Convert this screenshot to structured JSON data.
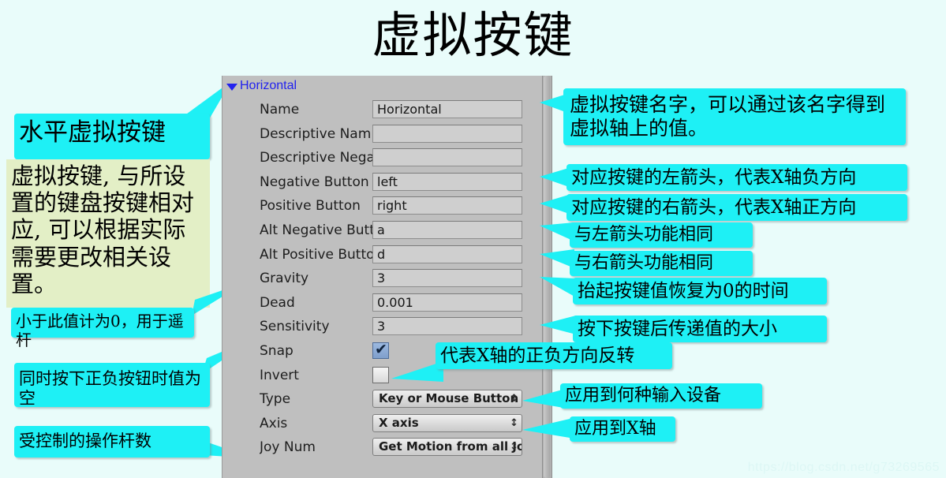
{
  "page": {
    "title": "虚拟按键",
    "watermark": "https://blog.csdn.net/g73269565",
    "background_color": "#e9fcfa",
    "note_color": "#1ef0f5",
    "note_green_color": "#e3efc6",
    "panel_color": "#bfbfbf",
    "accent_color": "#2222ee"
  },
  "inspector": {
    "foldout": {
      "label": "Horizontal",
      "icon": "triangle-down-icon",
      "expanded": true
    },
    "rows": [
      {
        "label": "Name",
        "kind": "text",
        "value": "Horizontal"
      },
      {
        "label": "Descriptive Nam",
        "kind": "text",
        "value": ""
      },
      {
        "label": "Descriptive Nega",
        "kind": "text",
        "value": ""
      },
      {
        "label": "Negative Button",
        "kind": "text",
        "value": "left"
      },
      {
        "label": "Positive Button",
        "kind": "text",
        "value": "right"
      },
      {
        "label": "Alt Negative Butt",
        "kind": "text",
        "value": "a"
      },
      {
        "label": "Alt Positive Butto",
        "kind": "text",
        "value": "d"
      },
      {
        "label": "Gravity",
        "kind": "text",
        "value": "3"
      },
      {
        "label": "Dead",
        "kind": "text",
        "value": "0.001"
      },
      {
        "label": "Sensitivity",
        "kind": "text",
        "value": "3"
      },
      {
        "label": "Snap",
        "kind": "checkbox",
        "value": "checked"
      },
      {
        "label": "Invert",
        "kind": "checkbox",
        "value": "unchecked"
      },
      {
        "label": "Type",
        "kind": "popup",
        "value": "Key or Mouse Button"
      },
      {
        "label": "Axis",
        "kind": "popup",
        "value": "X axis"
      },
      {
        "label": "Joy Num",
        "kind": "popup",
        "value": "Get Motion from all Joy"
      }
    ]
  },
  "annotations": {
    "title_callout": "水平虚拟按键",
    "description_box": "虚拟按键, 与所设置的键盘按键相对应, 可以根据实际需要更改相关设置。",
    "name_note": "虚拟按键名字，可以通过该名字得到虚拟轴上的值。",
    "negative_button_note": "对应按键的左箭头，代表X轴负方向",
    "positive_button_note": "对应按键的右箭头，代表X轴正方向",
    "alt_negative_note": "与左箭头功能相同",
    "alt_positive_note": "与右箭头功能相同",
    "gravity_note": "抬起按键值恢复为0的时间",
    "sensitivity_note": "按下按键后传递值的大小",
    "dead_note": "小于此值计为0，用于遥杆",
    "snap_note": "同时按下正负按钮时值为空",
    "invert_note": "代表X轴的正负方向反转",
    "type_note": "应用到何种输入设备",
    "axis_note": "应用到X轴",
    "joynum_note": "受控制的操作杆数"
  }
}
